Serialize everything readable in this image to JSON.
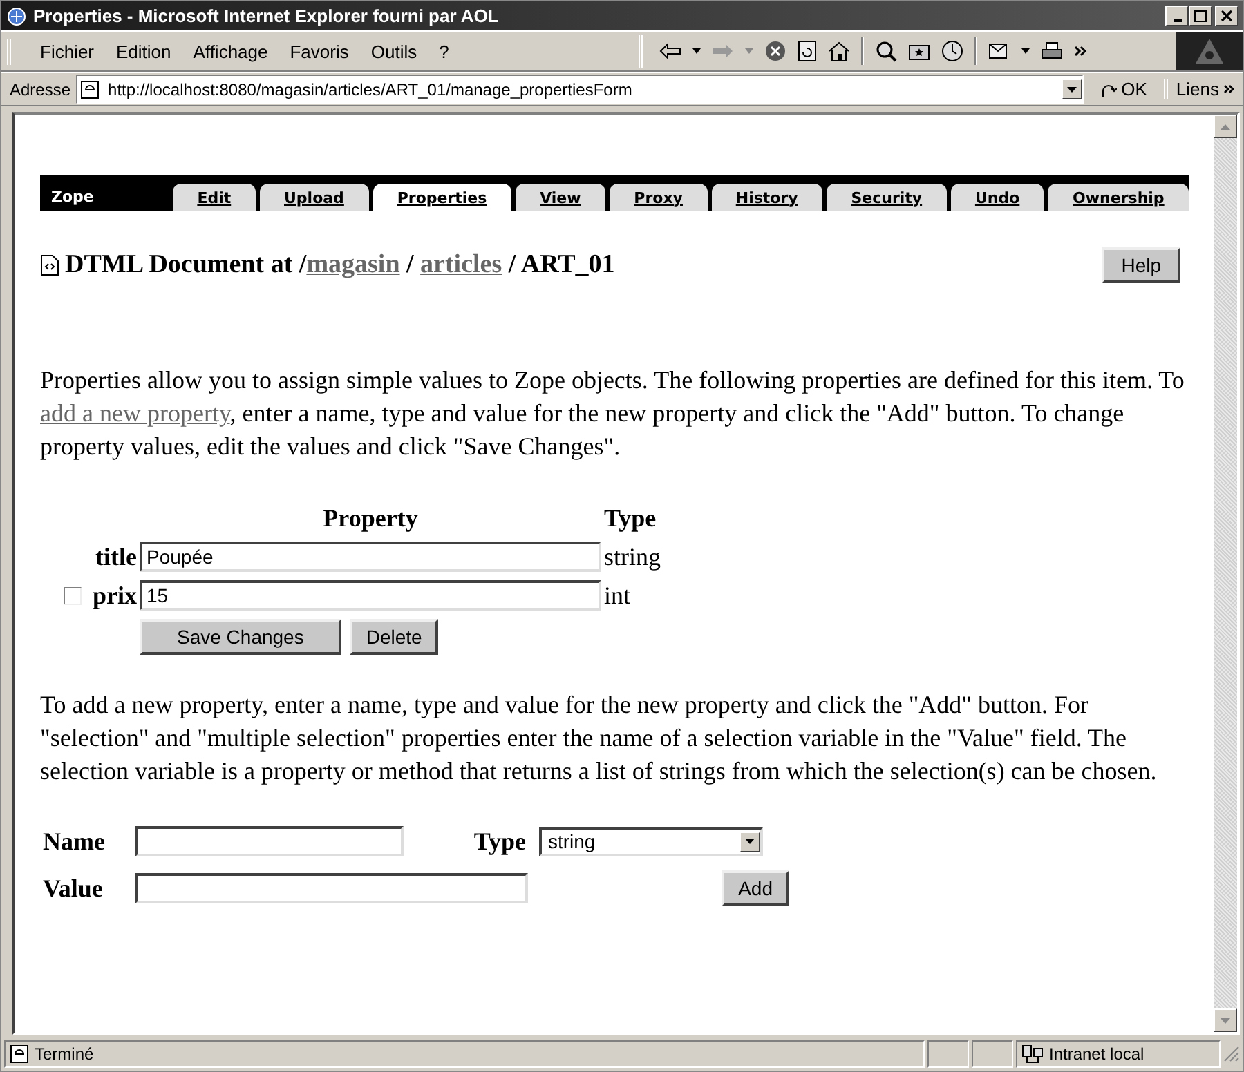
{
  "window": {
    "title": "Properties - Microsoft Internet Explorer fourni par AOL"
  },
  "menu": [
    "Fichier",
    "Edition",
    "Affichage",
    "Favoris",
    "Outils",
    "?"
  ],
  "address_bar": {
    "label": "Adresse",
    "url": "http://localhost:8080/magasin/articles/ART_01/manage_propertiesForm",
    "go": "OK",
    "links": "Liens"
  },
  "zope_tabs": {
    "logo": "Zope",
    "tabs": [
      {
        "label": "Edit",
        "selected": false
      },
      {
        "label": "Upload",
        "selected": false
      },
      {
        "label": "Properties",
        "selected": true
      },
      {
        "label": "View",
        "selected": false
      },
      {
        "label": "Proxy",
        "selected": false
      },
      {
        "label": "History",
        "selected": false
      },
      {
        "label": "Security",
        "selected": false
      },
      {
        "label": "Undo",
        "selected": false
      },
      {
        "label": "Ownership",
        "selected": false
      }
    ]
  },
  "heading": [
    {
      "kind": "text",
      "text": "DTML Document at /"
    },
    {
      "kind": "link",
      "text": "magasin"
    },
    {
      "kind": "text",
      "text": " / "
    },
    {
      "kind": "link",
      "text": "articles"
    },
    {
      "kind": "text",
      "text": " / ART_01"
    }
  ],
  "help_button": "Help",
  "intro": [
    {
      "kind": "text",
      "text": "Properties allow you to assign simple values to Zope objects. The following properties are defined for this item. To "
    },
    {
      "kind": "link",
      "text": "add a new property"
    },
    {
      "kind": "text",
      "text": ", enter a name, type and value for the new property and click the \"Add\" button. To change property values, edit the values and click \"Save Changes\"."
    }
  ],
  "properties": {
    "columns": [
      "Property",
      "Type"
    ],
    "rows": [
      {
        "name": "title",
        "value": "Poupée",
        "type": "string"
      },
      {
        "name": "prix",
        "value": "15",
        "type": "int",
        "checkbox": {
          "checked": false
        }
      }
    ],
    "buttons": [
      "Save Changes",
      "Delete"
    ]
  },
  "add_help": "To add a new property, enter a name, type and value for the new property and click the \"Add\" button. For \"selection\" and \"multiple selection\" properties enter the name of a selection variable in the \"Value\" field. The selection variable is a property or method that returns a list of strings from which the selection(s) can be chosen.",
  "add_form": {
    "name_label": "Name",
    "type_label": "Type",
    "type_value": "string",
    "value_label": "Value",
    "add_button": "Add"
  },
  "status_bar": {
    "text": "Terminé",
    "zone": "Intranet local"
  }
}
